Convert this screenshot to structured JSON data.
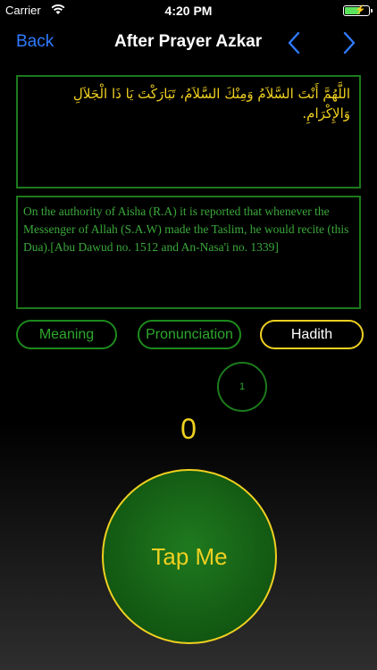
{
  "status_bar": {
    "carrier": "Carrier",
    "time": "4:20 PM",
    "battery_color": "#5ce35c"
  },
  "nav": {
    "back_label": "Back",
    "title": "After Prayer Azkar",
    "prev_icon": "chevron-left-icon",
    "next_icon": "chevron-right-icon",
    "accent": "#2f7bff"
  },
  "dua": {
    "arabic": "اللَّهُمَّ أَنْتَ السَّلاَمُ وَمِنْكَ السَّلاَمُ، تَبَارَكْتَ يَا ذَا الْجَلاَلِ وَالإِكْرَامِ."
  },
  "hadith": {
    "text": "On the authority of Aisha (R.A) it is reported that whenever the Messenger of Allah (S.A.W) made the Taslim, he would recite (this Dua).[Abu Dawud no. 1512 and An-Nasa'i no. 1339]"
  },
  "tabs": [
    {
      "label": "Meaning"
    },
    {
      "label": "Pronunciation"
    },
    {
      "label": "Hadith",
      "selected": true
    }
  ],
  "repeat_count": "1",
  "counter": "0",
  "tap_button": {
    "label": "Tap Me"
  },
  "colors": {
    "gold": "#f0d020",
    "green": "#2ea82e",
    "border_green": "#1c7a1c"
  }
}
